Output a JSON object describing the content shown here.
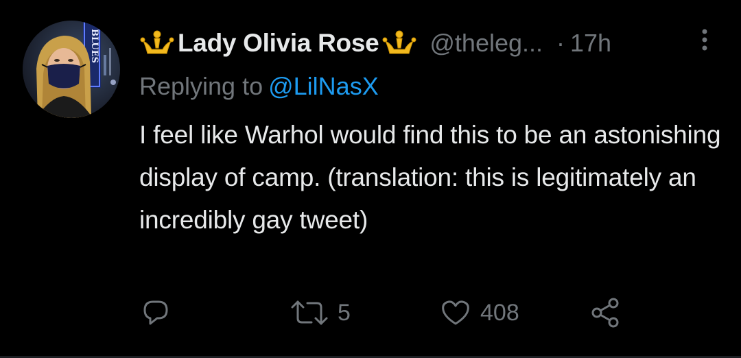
{
  "tweet": {
    "author": {
      "display_name": "Lady Olivia Rose",
      "handle": "@theleg...",
      "avatar_sign_text": "BLUES"
    },
    "separator": "·",
    "timestamp": "17h",
    "reply_prefix": "Replying to",
    "reply_mention": "@LilNasX",
    "text": "I feel like Warhol would find this to be an astonishing display of camp. (translation: this is legitimately an incredibly gay tweet)",
    "actions": {
      "reply_count": "",
      "retweet_count": "5",
      "like_count": "408"
    }
  },
  "colors": {
    "background": "#000000",
    "primary_text": "#e7e9ea",
    "secondary_text": "#71767b",
    "link": "#1d9bf0",
    "crown_emoji": "#f2b91e"
  },
  "icons": {
    "name_emoji": "crown-icon",
    "more": "more-vertical-icon",
    "reply": "reply-icon",
    "retweet": "retweet-icon",
    "like": "heart-icon",
    "share": "share-icon"
  }
}
